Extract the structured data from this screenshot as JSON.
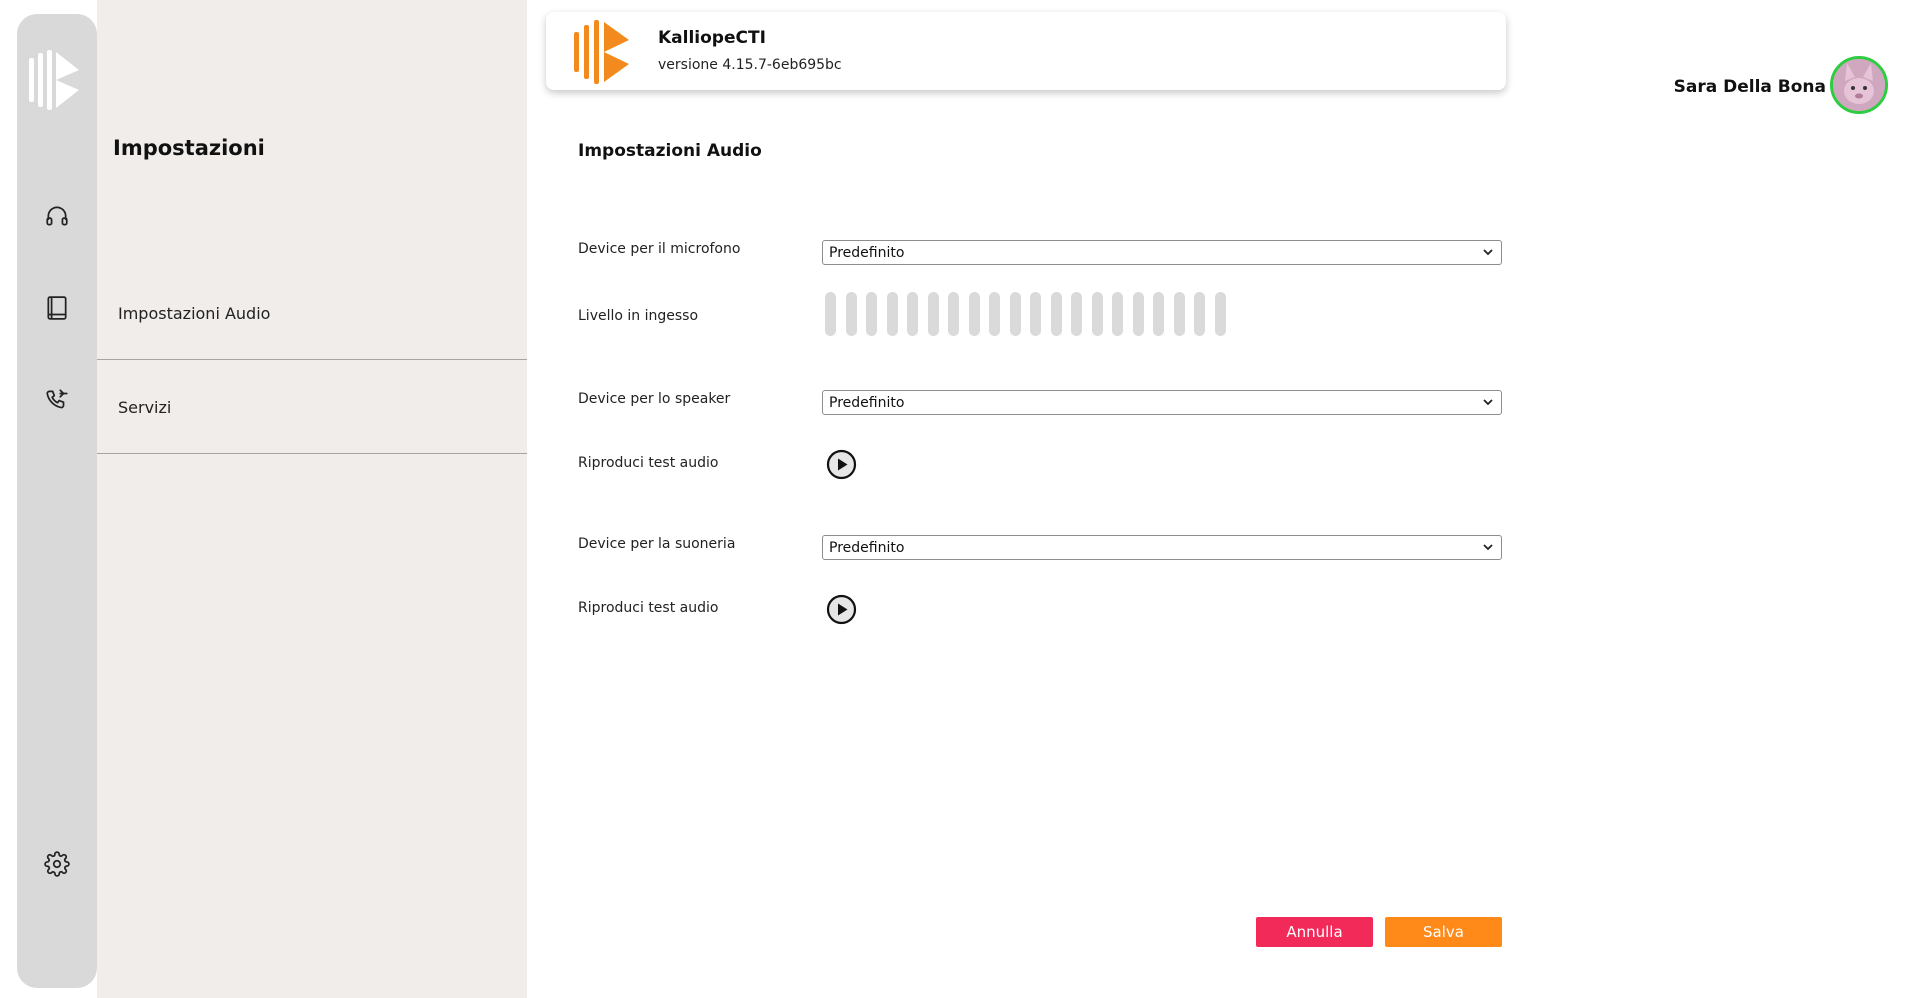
{
  "app": {
    "name": "KalliopeCTI",
    "version": "versione 4.15.7-6eb695bc"
  },
  "user": {
    "name": "Sara Della Bona",
    "status_color": "#2ecc40"
  },
  "rail": {
    "items": [
      {
        "icon": "headset-icon"
      },
      {
        "icon": "book-icon"
      },
      {
        "icon": "phone-transfer-icon"
      },
      {
        "icon": "gear-icon"
      }
    ]
  },
  "panel": {
    "title": "Impostazioni",
    "items": [
      {
        "label": "Impostazioni Audio"
      },
      {
        "label": "Servizi"
      }
    ]
  },
  "audio": {
    "title": "Impostazioni Audio",
    "mic_label": "Device per il microfono",
    "mic_value": "Predefinito",
    "level_label": "Livello in ingesso",
    "level_bars": 20,
    "speaker_label": "Device per lo speaker",
    "speaker_value": "Predefinito",
    "play_label_1": "Riproduci test audio",
    "ringer_label": "Device per la suoneria",
    "ringer_value": "Predefinito",
    "play_label_2": "Riproduci test audio"
  },
  "actions": {
    "cancel_label": "Annulla",
    "save_label": "Salva"
  },
  "colors": {
    "brand_orange": "#f28a1e",
    "cancel": "#f22a5a",
    "save": "#ff8a1a"
  }
}
